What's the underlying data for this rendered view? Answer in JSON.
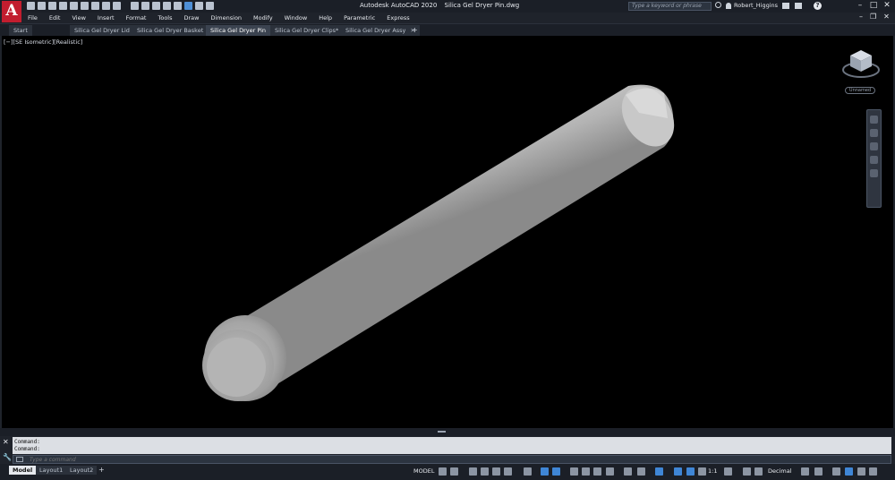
{
  "app": {
    "logo": "A",
    "product": "Autodesk AutoCAD 2020",
    "filename": "Silica Gel Dryer Pin.dwg"
  },
  "search": {
    "placeholder": "Type a keyword or phrase"
  },
  "user": {
    "name": "Robert_Higgins"
  },
  "menu": [
    "File",
    "Edit",
    "View",
    "Insert",
    "Format",
    "Tools",
    "Draw",
    "Dimension",
    "Modify",
    "Window",
    "Help",
    "Parametric",
    "Express"
  ],
  "tabs": [
    {
      "label": "Start",
      "closable": false,
      "active": false
    },
    {
      "label": "Silica Gel Dryer Lid",
      "closable": true,
      "active": false
    },
    {
      "label": "Silica Gel Dryer Basket",
      "closable": true,
      "active": false
    },
    {
      "label": "Silica Gel Dryer Pin",
      "closable": true,
      "active": true
    },
    {
      "label": "Silica Gel Dryer Clips*",
      "closable": true,
      "active": false
    },
    {
      "label": "Silica Gel Dryer Assy",
      "closable": true,
      "active": false
    }
  ],
  "viewport": {
    "label": "[−][SE Isometric][Realistic]",
    "wcs": "Unnamed"
  },
  "command": {
    "history": [
      "Command:",
      "Command:"
    ],
    "placeholder": "Type a command"
  },
  "status": {
    "layouts": [
      "Model",
      "Layout1",
      "Layout2"
    ],
    "space": "MODEL",
    "scale": "1:1",
    "units": "Decimal"
  },
  "colors": {
    "accent": "#3f86d6",
    "logo": "#c21d2f",
    "background": "#000000"
  }
}
